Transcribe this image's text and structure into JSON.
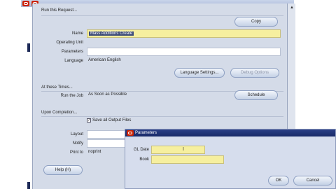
{
  "request": {
    "section_title": "Run this Request...",
    "copy_button": "Copy",
    "name_label": "Name",
    "name_value": "Mass Additions Create",
    "operating_unit_label": "Operating Unit",
    "parameters_label": "Parameters",
    "language_label": "Language",
    "language_value": "American English",
    "language_settings_button": "Language Settings...",
    "debug_options_button": "Debug Options"
  },
  "times": {
    "section_title": "At these Times...",
    "run_job_label": "Run the Job",
    "run_job_value": "As Soon as Possible",
    "schedule_button": "Schedule"
  },
  "completion": {
    "section_title": "Upon Completion...",
    "save_output_label": "Save all Output Files",
    "save_output_checked": true,
    "layout_label": "Layout",
    "notify_label": "Notify",
    "print_to_label": "Print to",
    "print_to_value": "noprint"
  },
  "footer": {
    "help_button": "Help (H)"
  },
  "dialog": {
    "title": "Parameters",
    "gl_date_label": "GL Date",
    "book_label": "Book",
    "ok_button": "OK",
    "cancel_button": "Cancel"
  },
  "icons": {
    "app_icon": "oracle-app-icon",
    "scroll_up": "scroll-up-arrow-icon"
  },
  "colors": {
    "required_field": "#f6ef9f",
    "title_bar": "#1f3275",
    "app_icon": "#cc2200"
  }
}
